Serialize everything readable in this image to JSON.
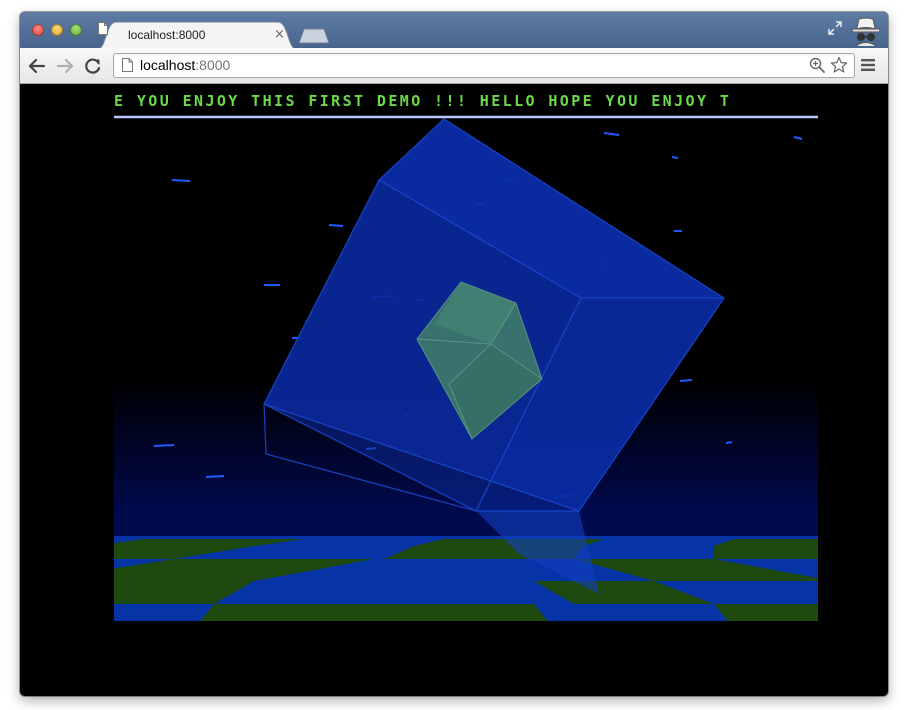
{
  "window": {
    "title": "localhost:8000"
  },
  "tab": {
    "title": "localhost:8000",
    "close_label": "×",
    "favicon": "page-icon"
  },
  "toolbar": {
    "back_icon": "back-arrow-icon",
    "forward_icon": "forward-arrow-icon",
    "reload_icon": "reload-icon",
    "url_host": "localhost",
    "url_port": ":8000",
    "zoom_icon": "zoom-icon",
    "bookmark_icon": "star-icon",
    "menu_icon": "hamburger-menu-icon"
  },
  "demo": {
    "scroller_text": "E YOU ENJOY THIS FIRST DEMO !!! HELLO HOPE YOU ENJOY T",
    "colors": {
      "scroller": "#6bd94a",
      "sky_dark": "#000000",
      "sky_horizon": "#000a4d",
      "cube_outer": "#0a2aa0",
      "cube_inner": "#3f7a6a",
      "floor_blue": "#0633a6",
      "floor_green": "#1e4a10",
      "stars": "#1f5cff"
    }
  },
  "colors": {
    "titlebar": "#52719a",
    "toolbar": "#eeeeee",
    "page_bg": "#000000"
  }
}
